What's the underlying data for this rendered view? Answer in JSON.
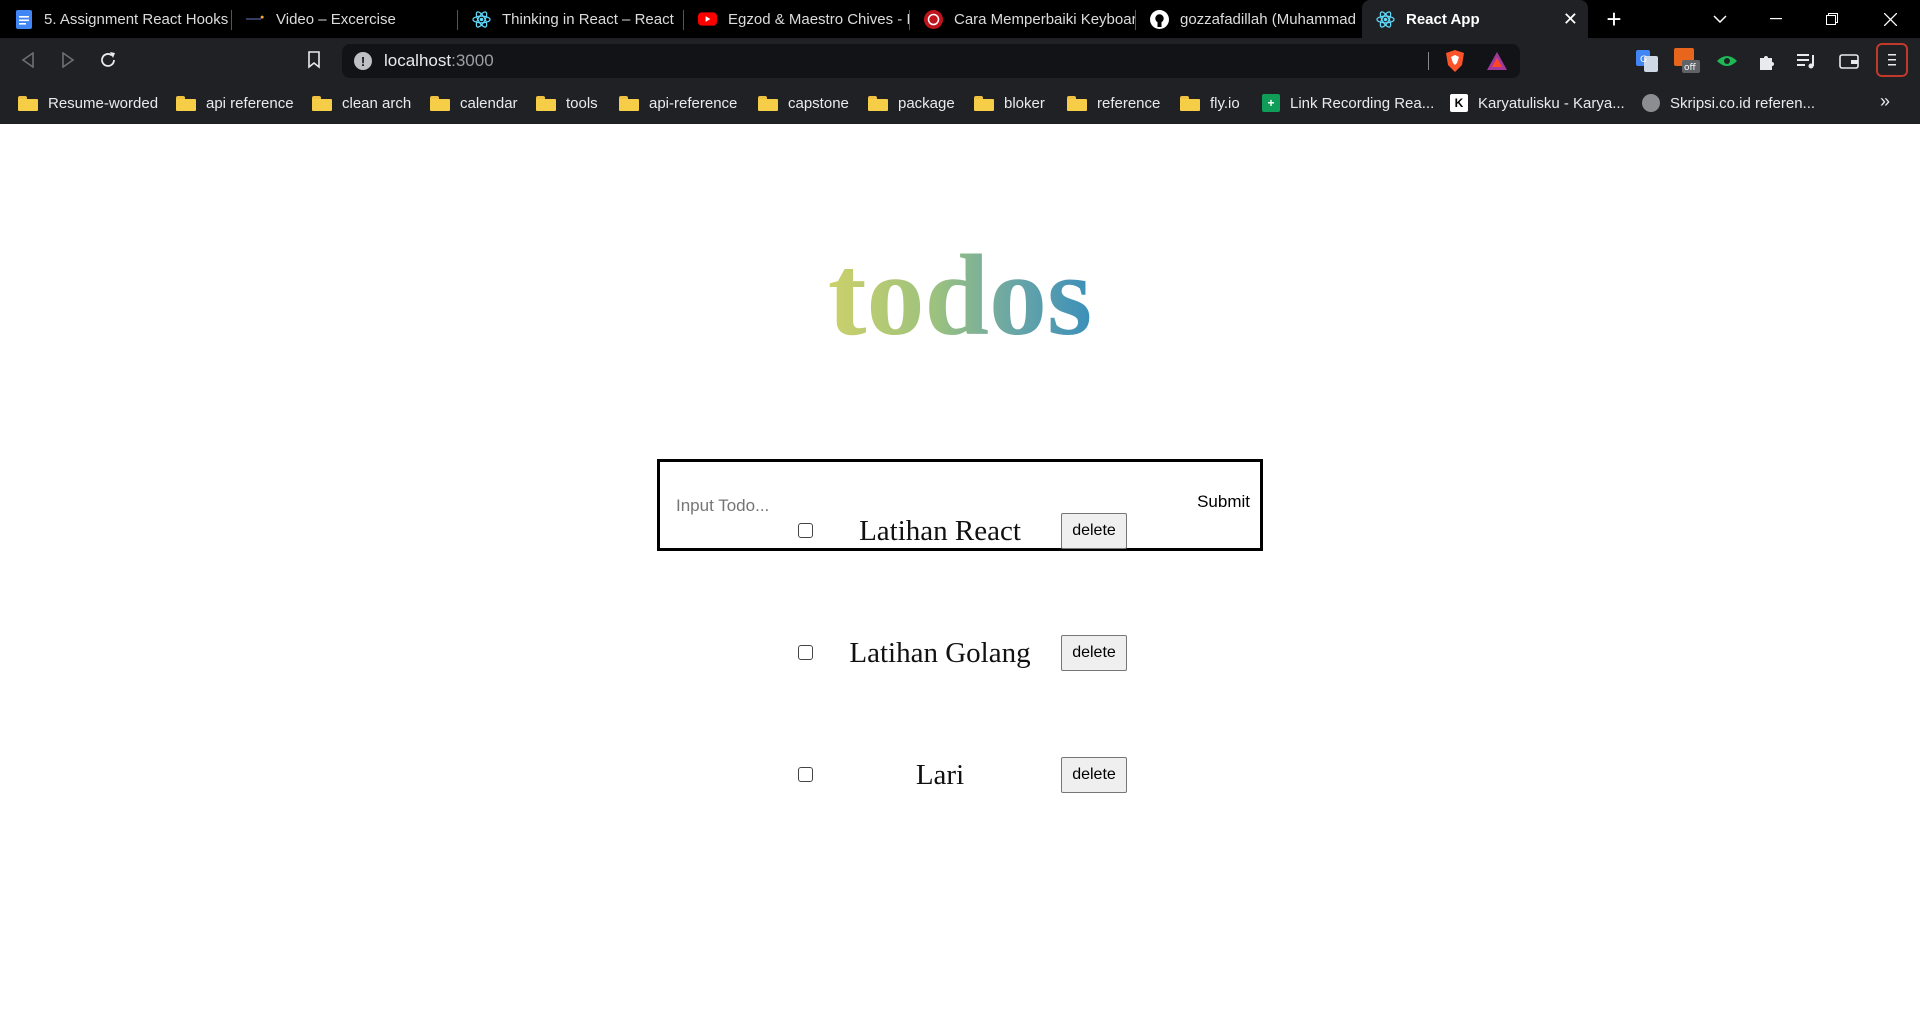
{
  "browser": {
    "tabs": [
      {
        "title": "5. Assignment React Hooks",
        "icon": "docs-icon"
      },
      {
        "title": "Video – Excercise",
        "icon": "video-icon"
      },
      {
        "title": "Thinking in React – React",
        "icon": "react-icon"
      },
      {
        "title": "Egzod & Maestro Chives - I",
        "icon": "youtube-icon"
      },
      {
        "title": "Cara Memperbaiki Keyboar",
        "icon": "site-icon"
      },
      {
        "title": "gozzafadillah (Muhammad",
        "icon": "github-icon"
      },
      {
        "title": "React App",
        "icon": "react-icon",
        "active": true
      }
    ],
    "address": {
      "host": "localhost",
      "port": ":3000"
    },
    "bookmarks": [
      {
        "label": "Resume-worded",
        "type": "folder"
      },
      {
        "label": "api reference",
        "type": "folder"
      },
      {
        "label": "clean arch",
        "type": "folder"
      },
      {
        "label": "calendar",
        "type": "folder"
      },
      {
        "label": "tools",
        "type": "folder"
      },
      {
        "label": "api-reference",
        "type": "folder"
      },
      {
        "label": "capstone",
        "type": "folder"
      },
      {
        "label": "package",
        "type": "folder"
      },
      {
        "label": "bloker",
        "type": "folder"
      },
      {
        "label": "reference",
        "type": "folder"
      },
      {
        "label": "fly.io",
        "type": "folder"
      },
      {
        "label": "Link Recording Rea...",
        "type": "link",
        "icon": "sheets-icon"
      },
      {
        "label": "Karyatulisku - Karya...",
        "type": "link",
        "icon": "k-icon"
      },
      {
        "label": "Skripsi.co.id referen...",
        "type": "link",
        "icon": "globe-icon"
      }
    ],
    "bookmarks_more": "»"
  },
  "app": {
    "logo": "todos",
    "logo_colors": [
      "#cdd16a",
      "#9cc27e",
      "#6aa6a6",
      "#3b8fba"
    ],
    "input": {
      "placeholder": "Input Todo...",
      "value": ""
    },
    "submit_label": "Submit",
    "todos": [
      {
        "title": "Latihan React",
        "completed": false,
        "delete_label": "delete"
      },
      {
        "title": "Latihan Golang",
        "completed": false,
        "delete_label": "delete"
      },
      {
        "title": "Lari",
        "completed": false,
        "delete_label": "delete"
      }
    ]
  }
}
